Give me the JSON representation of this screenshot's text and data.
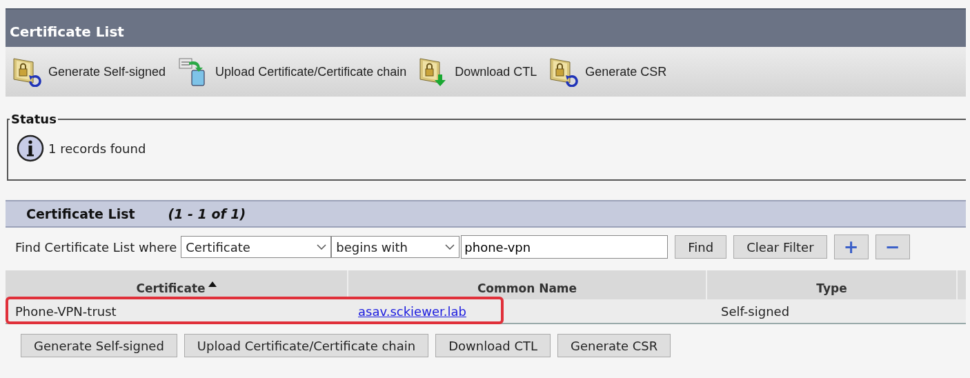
{
  "window": {
    "title": "Certificate List"
  },
  "toolbar": [
    {
      "label": "Generate Self-signed",
      "kind": "refresh"
    },
    {
      "label": "Upload Certificate/Certificate chain",
      "kind": "upload"
    },
    {
      "label": "Download CTL",
      "kind": "download"
    },
    {
      "label": "Generate CSR",
      "kind": "refresh"
    }
  ],
  "status": {
    "legend": "Status",
    "message": "1 records found"
  },
  "list": {
    "title": "Certificate List",
    "range": "(1 - 1 of 1)"
  },
  "filter": {
    "label": "Find Certificate List where",
    "field": "Certificate",
    "operator": "begins with",
    "value": "phone-vpn",
    "buttons": [
      "Find",
      "Clear Filter"
    ],
    "add": "+",
    "remove": "−"
  },
  "table": {
    "columns": [
      {
        "label": "Certificate",
        "sorted": true
      },
      {
        "label": "Common Name",
        "sorted": false
      },
      {
        "label": "Type",
        "sorted": false
      }
    ],
    "rows": [
      {
        "certificate": "Phone-VPN-trust",
        "common_name": "asav.sckiewer.lab",
        "type": "Self-signed",
        "highlighted": true
      }
    ]
  },
  "buttons": [
    "Generate Self-signed",
    "Upload Certificate/Certificate chain",
    "Download CTL",
    "Generate CSR"
  ]
}
